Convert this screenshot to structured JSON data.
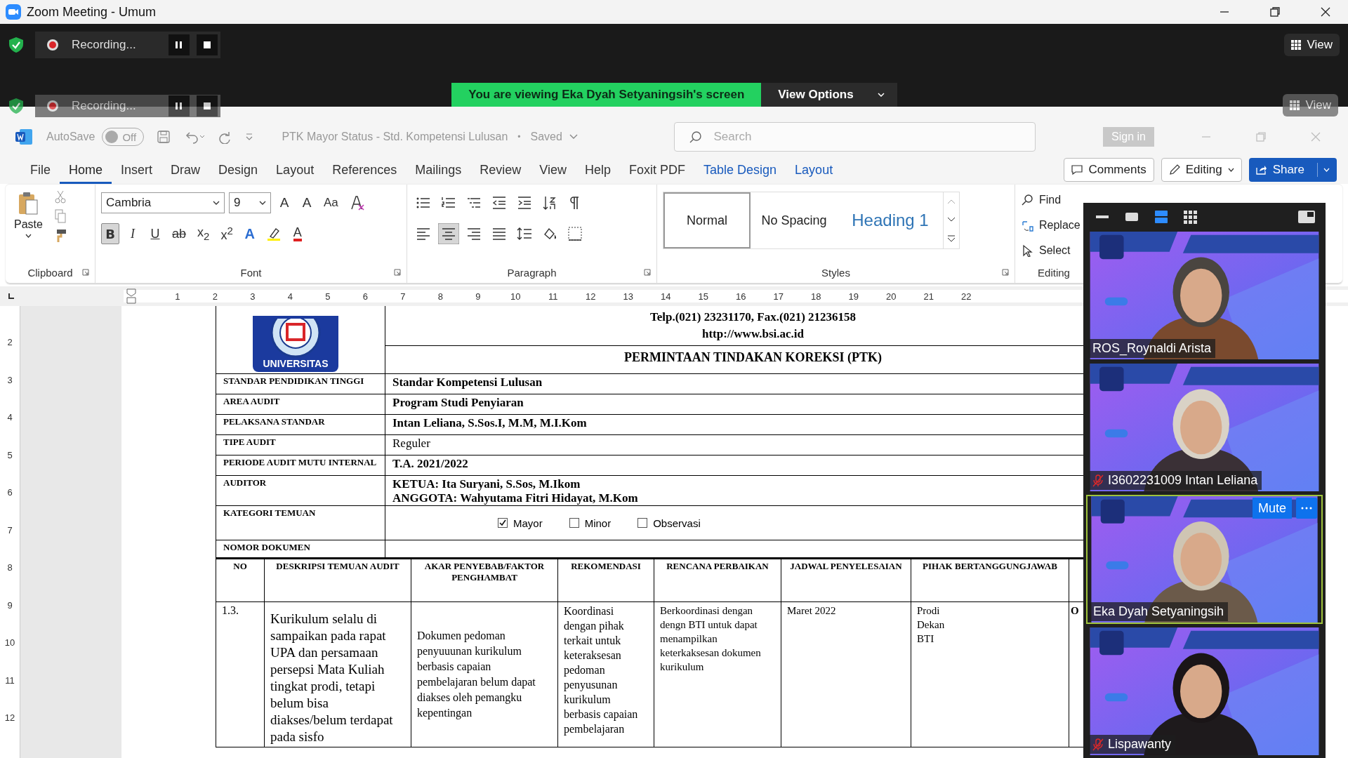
{
  "window": {
    "title": "Zoom Meeting - Umum"
  },
  "recording_bars": [
    {
      "label": "Recording..."
    },
    {
      "label": "Recording..."
    }
  ],
  "view_buttons": [
    {
      "label": "View"
    },
    {
      "label": "View"
    }
  ],
  "share_banner": {
    "text": "You are viewing Eka Dyah Setyaningsih's screen",
    "options": "View Options"
  },
  "word": {
    "autosave": {
      "label": "AutoSave",
      "on": false,
      "state_text": "Off"
    },
    "doc_title": "PTK Mayor Status - Std. Kompetensi Lulusan",
    "separator": "•",
    "save_state": "Saved",
    "search": {
      "placeholder": "Search"
    },
    "sign_in": "Sign in",
    "tabs": [
      {
        "label": "File",
        "selected": false,
        "kind": "normal"
      },
      {
        "label": "Home",
        "selected": true,
        "kind": "normal"
      },
      {
        "label": "Insert",
        "selected": false,
        "kind": "normal"
      },
      {
        "label": "Draw",
        "selected": false,
        "kind": "normal"
      },
      {
        "label": "Design",
        "selected": false,
        "kind": "normal"
      },
      {
        "label": "Layout",
        "selected": false,
        "kind": "normal"
      },
      {
        "label": "References",
        "selected": false,
        "kind": "normal"
      },
      {
        "label": "Mailings",
        "selected": false,
        "kind": "normal"
      },
      {
        "label": "Review",
        "selected": false,
        "kind": "normal"
      },
      {
        "label": "View",
        "selected": false,
        "kind": "normal"
      },
      {
        "label": "Help",
        "selected": false,
        "kind": "normal"
      },
      {
        "label": "Foxit PDF",
        "selected": false,
        "kind": "normal"
      },
      {
        "label": "Table Design",
        "selected": false,
        "kind": "contextual"
      },
      {
        "label": "Layout",
        "selected": false,
        "kind": "contextual"
      }
    ],
    "comments": "Comments",
    "editing": "Editing",
    "share": "Share",
    "ribbon": {
      "clipboard": {
        "paste": "Paste",
        "group": "Clipboard"
      },
      "font": {
        "name": "Cambria",
        "size": "9",
        "group": "Font",
        "top_buttons": [
          {
            "label": "A",
            "kind": "grow"
          },
          {
            "label": "A",
            "kind": "shrink"
          },
          {
            "label": "Aa",
            "kind": "case"
          }
        ],
        "format_buttons": [
          {
            "label": "B",
            "kind": "bold",
            "selected": true
          },
          {
            "label": "I",
            "kind": "italic",
            "selected": false
          },
          {
            "label": "U",
            "kind": "underline",
            "selected": false
          },
          {
            "label": "ab",
            "kind": "strike",
            "selected": false
          },
          {
            "label": "x$_{2}$",
            "kind": "sub",
            "selected": false
          },
          {
            "label": "x$^{2}$",
            "kind": "sup",
            "selected": false
          },
          {
            "label": "A",
            "kind": "effects",
            "selected": false
          },
          {
            "kind": "highlight",
            "selected": false
          },
          {
            "label": "A",
            "kind": "color",
            "selected": false
          }
        ]
      },
      "paragraph": {
        "group": "Paragraph",
        "alignments": [
          {
            "selected": false
          },
          {
            "selected": true
          },
          {
            "selected": false
          },
          {
            "selected": false
          }
        ]
      },
      "styles": {
        "group": "Styles",
        "items": [
          {
            "label": "Normal",
            "selected": true,
            "kind": "normal"
          },
          {
            "label": "No Spacing",
            "selected": false,
            "kind": "normal"
          },
          {
            "label": "Heading 1",
            "selected": false,
            "kind": "heading"
          }
        ]
      },
      "editing": {
        "group": "Editing",
        "items": [
          {
            "label": "Find",
            "kind": "find"
          },
          {
            "label": "Replace",
            "kind": "replace"
          },
          {
            "label": "Select",
            "kind": "select"
          }
        ]
      }
    },
    "ruler_numbers": [
      "1",
      "2",
      "3",
      "4",
      "5",
      "6",
      "7",
      "8",
      "9",
      "10",
      "11",
      "12",
      "13",
      "14",
      "15",
      "16",
      "17",
      "18",
      "19",
      "20",
      "21",
      "22"
    ],
    "vertical_ruler_numbers": [
      "2",
      "3",
      "4",
      "5",
      "6",
      "7",
      "8",
      "9",
      "10",
      "11",
      "12"
    ]
  },
  "document": {
    "logo_text": "UNIVERSITAS",
    "contact": "Telp.(021) 23231170, Fax.(021) 21236158",
    "website": "http://www.bsi.ac.id",
    "form_title": "PERMINTAAN TINDAKAN KOREKSI (PTK)",
    "fields": [
      {
        "label": "STANDAR PENDIDIKAN TINGGI",
        "value": "Standar Kompetensi Lulusan",
        "bold": true
      },
      {
        "label": "AREA AUDIT",
        "value": "Program Studi Penyiaran",
        "bold": true
      },
      {
        "label": "PELAKSANA STANDAR",
        "value": "Intan Leliana, S.Sos.I, M.M, M.I.Kom",
        "bold": true
      },
      {
        "label": "TIPE AUDIT",
        "value": "Reguler",
        "bold": false
      },
      {
        "label": "PERIODE AUDIT MUTU INTERNAL",
        "value": "T.A. 2021/2022",
        "bold": true
      },
      {
        "label": "AUDITOR",
        "value": "KETUA: Ita Suryani, S.Sos, M.Ikom\nANGGOTA: Wahyutama Fitri Hidayat, M.Kom",
        "bold": true
      }
    ],
    "category": {
      "label": "KATEGORI TEMUAN",
      "options": [
        {
          "label": "Mayor",
          "checked": true
        },
        {
          "label": "Minor",
          "checked": false
        },
        {
          "label": "Observasi",
          "checked": false
        }
      ]
    },
    "document_number": {
      "label": "NOMOR DOKUMEN"
    },
    "findings": {
      "columns": [
        "NO",
        "DESKRIPSI TEMUAN AUDIT",
        "AKAR PENYEBAB/FAKTOR PENGHAMBAT",
        "REKOMENDASI",
        "RENCANA PERBAIKAN",
        "JADWAL PENYELESAIAN",
        "PIHAK BERTANGGUNGJAWAB"
      ],
      "rows": [
        {
          "cells": [
            "1.3.",
            "Kurikulum selalu di sampaikan pada rapat UPA dan persamaan persepsi Mata Kuliah tingkat prodi, tetapi belum bisa diakses/belum terdapat pada sisfo",
            "Dokumen pedoman penyuuunan kurikulum berbasis capaian pembelajaran belum dapat diakses oleh pemangku kepentingan",
            "Koordinasi dengan pihak terkait untuk keteraksesan pedoman penyusunan kurikulum berbasis capaian pembelajaran",
            "Berkoordinasi dengan dengn BTI untuk dapat menampilkan keterkaksesan dokumen kurikulum",
            "Maret 2022",
            "Prodi\nDekan\nBTI",
            "O"
          ]
        }
      ]
    }
  },
  "video_panel": {
    "layouts": [
      {
        "kind": "minimize",
        "selected": false
      },
      {
        "kind": "single",
        "selected": false
      },
      {
        "kind": "speaker",
        "selected": true
      },
      {
        "kind": "gallery",
        "selected": false
      }
    ],
    "participants": [
      {
        "name": "ROS_Roynaldi Arista",
        "muted": false,
        "active": false
      },
      {
        "name": "I3602231009 Intan Leliana",
        "muted": true,
        "active": false
      },
      {
        "name": "Eka Dyah Setyaningsih",
        "muted": false,
        "active": true,
        "mute_button": "Mute"
      },
      {
        "name": "Lispawanty",
        "muted": true,
        "active": false
      }
    ]
  }
}
